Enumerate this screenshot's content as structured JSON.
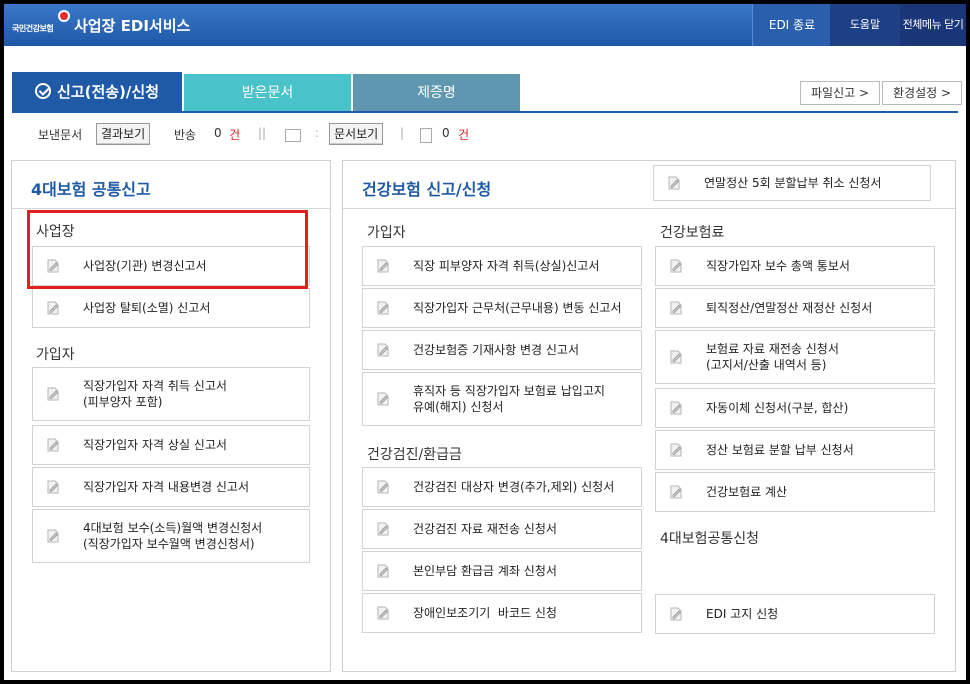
{
  "header": {
    "logo_small": "국민건강보험 마크",
    "logo_text": "국민건강보험",
    "app_title": "사업장 EDI서비스",
    "btn_edi_exit": "EDI 종료",
    "btn_help": "도움말",
    "btn_close_menu": "전체메뉴 닫기"
  },
  "tabs": {
    "report": "신고(전송)/신청",
    "received": "받은문서",
    "certificate": "제증명"
  },
  "toolbar": {
    "file_report": "파일신고 >",
    "settings": "환경설정 >"
  },
  "status": {
    "sent_label": "보낸문서",
    "result_btn": "결과보기",
    "returned_label": "반송",
    "returned_count": "0",
    "unit1": "건",
    "doc_btn": "문서보기",
    "doc_count": "0",
    "unit2": "건",
    "colon": ":"
  },
  "left_panel": {
    "title": "4대보험 공통신고",
    "sec_workplace": "사업장",
    "sec_member": "가입자",
    "items": [
      "사업장(기관) 변경신고서",
      "사업장 탈퇴(소멸) 신고서",
      "직장가입자 자격 취득 신고서\n(피부양자 포함)",
      "직장가입자 자격 상실 신고서",
      "직장가입자 자격 내용변경 신고서",
      "4대보험 보수(소득)월액 변경신청서\n(직장가입자 보수월액 변경신청서)"
    ]
  },
  "right_panel": {
    "title": "건강보험 신고/신청",
    "top_item": "연말정산 5회 분할납부 취소 신청서",
    "sec_member": "가입자",
    "sec_checkup": "건강검진/환급금",
    "sec_premium": "건강보험료",
    "sec_common": "4대보험공통신청",
    "member_items": [
      "직장 피부양자 자격 취득(상실)신고서",
      "직장가입자 근무처(근무내용) 변동 신고서",
      "건강보험증 기재사항 변경 신고서",
      "휴직자 등 직장가입자 보험료 납입고지\n유예(해지) 신청서"
    ],
    "checkup_items": [
      "건강검진 대상자 변경(추가,제외) 신청서",
      "건강검진 자료 재전송 신청서",
      "본인부담 환급금 계좌 신청서",
      "장애인보조기기  바코드 신청"
    ],
    "premium_items": [
      "직장가입자 보수 총액 통보서",
      "퇴직정산/연말정산 재정산 신청서",
      "보험료 자료 재전송 신청서\n(고지서/산출 내역서 등)",
      "자동이체 신청서(구분, 합산)",
      "정산 보험료 분할 납부 신청서",
      "건강보험료 계산"
    ],
    "common_items": [
      "EDI 고지 신청"
    ]
  },
  "colors": {
    "brand_blue": "#1f5aa6",
    "tab_teal": "#49c3c9",
    "tab_slate": "#5f96b0",
    "highlight_red": "#e51f1f"
  }
}
